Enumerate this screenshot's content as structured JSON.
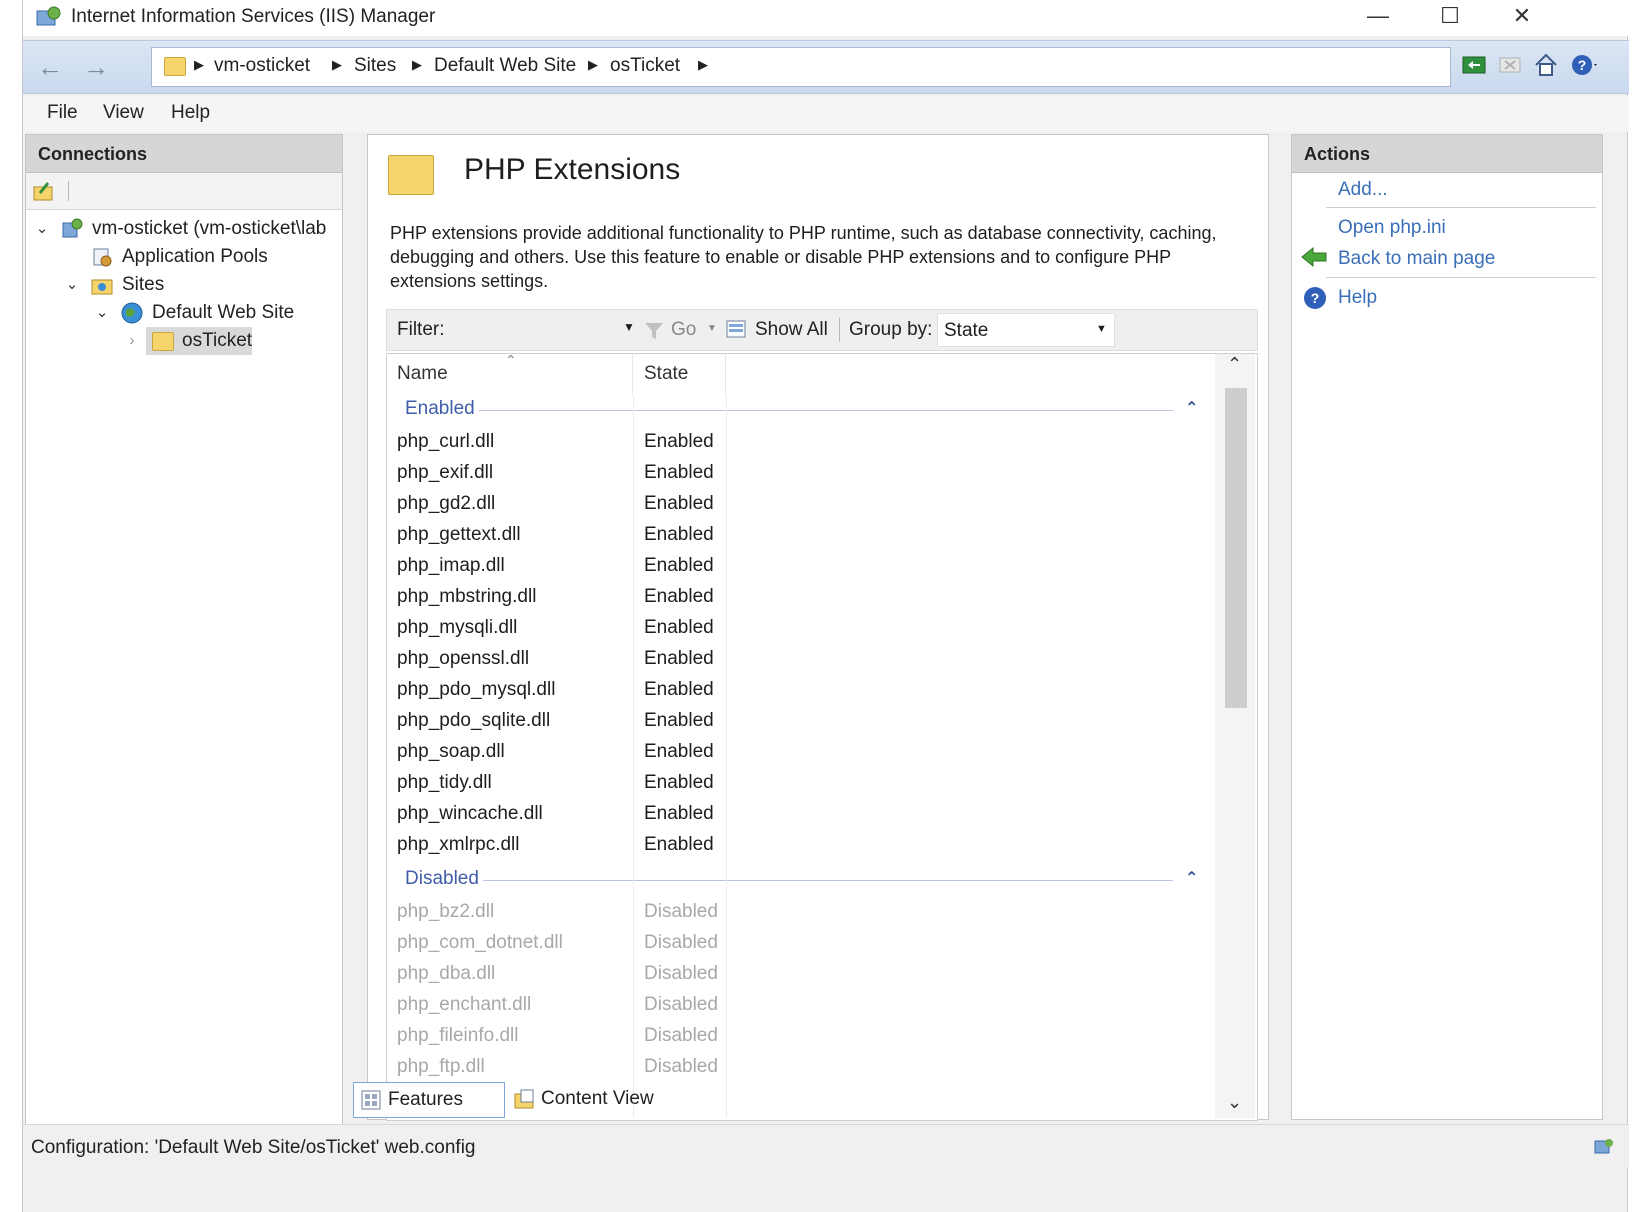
{
  "window": {
    "title": "Internet Information Services (IIS) Manager",
    "minimize": "—",
    "maximize": "☐",
    "close": "✕"
  },
  "address": {
    "back": "←",
    "forward": "→",
    "breadcrumbs": [
      "vm-osticket",
      "Sites",
      "Default Web Site",
      "osTicket"
    ],
    "separator": "▶"
  },
  "menu": {
    "file": "File",
    "view": "View",
    "help": "Help"
  },
  "connections": {
    "header": "Connections",
    "tree": [
      {
        "label": "vm-osticket (vm-osticket\\lab",
        "toggle": "⌄"
      },
      {
        "label": "Application Pools",
        "toggle": ""
      },
      {
        "label": "Sites",
        "toggle": "⌄"
      },
      {
        "label": "Default Web Site",
        "toggle": "⌄"
      },
      {
        "label": "osTicket",
        "toggle": "›"
      }
    ],
    "scroll_left": "‹",
    "scroll_right": "›"
  },
  "feature": {
    "title": "PHP Extensions",
    "description": "PHP extensions provide additional functionality to PHP runtime, such as database connectivity, caching, debugging and others. Use this feature to enable or disable PHP extensions and to configure PHP extensions settings.",
    "filter_label": "Filter:",
    "filter_value": "",
    "go_label": "Go",
    "show_all_label": "Show All",
    "group_by_label": "Group by:",
    "group_by_value": "State",
    "columns": {
      "name": "Name",
      "state": "State"
    },
    "groups": [
      {
        "label": "Enabled",
        "rows": [
          {
            "name": "php_curl.dll",
            "state": "Enabled"
          },
          {
            "name": "php_exif.dll",
            "state": "Enabled"
          },
          {
            "name": "php_gd2.dll",
            "state": "Enabled"
          },
          {
            "name": "php_gettext.dll",
            "state": "Enabled"
          },
          {
            "name": "php_imap.dll",
            "state": "Enabled"
          },
          {
            "name": "php_mbstring.dll",
            "state": "Enabled"
          },
          {
            "name": "php_mysqli.dll",
            "state": "Enabled"
          },
          {
            "name": "php_openssl.dll",
            "state": "Enabled"
          },
          {
            "name": "php_pdo_mysql.dll",
            "state": "Enabled"
          },
          {
            "name": "php_pdo_sqlite.dll",
            "state": "Enabled"
          },
          {
            "name": "php_soap.dll",
            "state": "Enabled"
          },
          {
            "name": "php_tidy.dll",
            "state": "Enabled"
          },
          {
            "name": "php_wincache.dll",
            "state": "Enabled"
          },
          {
            "name": "php_xmlrpc.dll",
            "state": "Enabled"
          }
        ]
      },
      {
        "label": "Disabled",
        "rows": [
          {
            "name": "php_bz2.dll",
            "state": "Disabled"
          },
          {
            "name": "php_com_dotnet.dll",
            "state": "Disabled"
          },
          {
            "name": "php_dba.dll",
            "state": "Disabled"
          },
          {
            "name": "php_enchant.dll",
            "state": "Disabled"
          },
          {
            "name": "php_fileinfo.dll",
            "state": "Disabled"
          },
          {
            "name": "php_ftp.dll",
            "state": "Disabled"
          }
        ]
      }
    ],
    "features_view": "Features View",
    "content_view": "Content View"
  },
  "actions": {
    "header": "Actions",
    "add": "Add...",
    "open_php_ini": "Open php.ini",
    "back_to_main": "Back to main page",
    "help": "Help"
  },
  "status": {
    "text": "Configuration: 'Default Web Site/osTicket' web.config"
  },
  "colors": {
    "link": "#3a6fb8",
    "group": "#3f5da8",
    "disabled_text": "#a8a8a8",
    "address_bar": "#c9d9ee"
  }
}
